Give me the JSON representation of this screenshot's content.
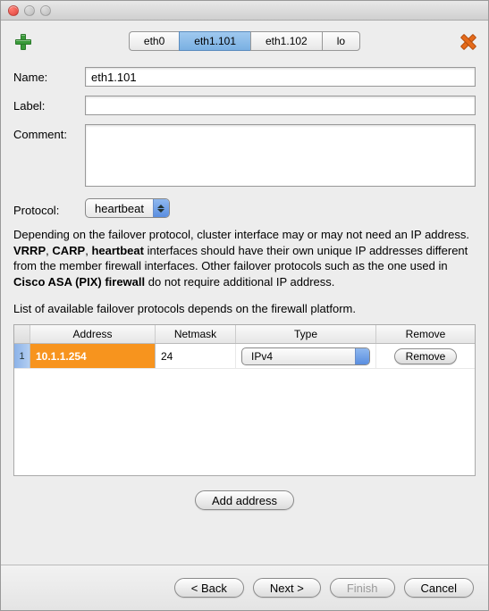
{
  "tabs": {
    "items": [
      "eth0",
      "eth1.101",
      "eth1.102",
      "lo"
    ],
    "active_index": 1
  },
  "form": {
    "name": {
      "label": "Name:",
      "value": "eth1.101"
    },
    "label_field": {
      "label": "Label:",
      "value": ""
    },
    "comment": {
      "label": "Comment:",
      "value": ""
    },
    "protocol": {
      "label": "Protocol:",
      "value": "heartbeat"
    }
  },
  "info": {
    "text_pre": "Depending on the failover protocol, cluster interface may or may not need an IP address. ",
    "bold1": "VRRP",
    "sep1": ", ",
    "bold2": "CARP",
    "sep2": ", ",
    "bold3": "heartbeat",
    "text_mid": " interfaces should have their own unique IP addresses different from the member firewall interfaces. Other failover protocols such as the one used in ",
    "bold4": "Cisco ASA (PIX) firewall",
    "text_post": " do not require additional IP address."
  },
  "sub": "List of available failover protocols depends on the firewall platform.",
  "table": {
    "headers": {
      "address": "Address",
      "netmask": "Netmask",
      "type": "Type",
      "remove": "Remove"
    },
    "rows": [
      {
        "num": "1",
        "address": "10.1.1.254",
        "netmask": "24",
        "type": "IPv4",
        "remove_label": "Remove"
      }
    ]
  },
  "buttons": {
    "add_address": "Add address",
    "back": "< Back",
    "next": "Next >",
    "finish": "Finish",
    "cancel": "Cancel"
  }
}
